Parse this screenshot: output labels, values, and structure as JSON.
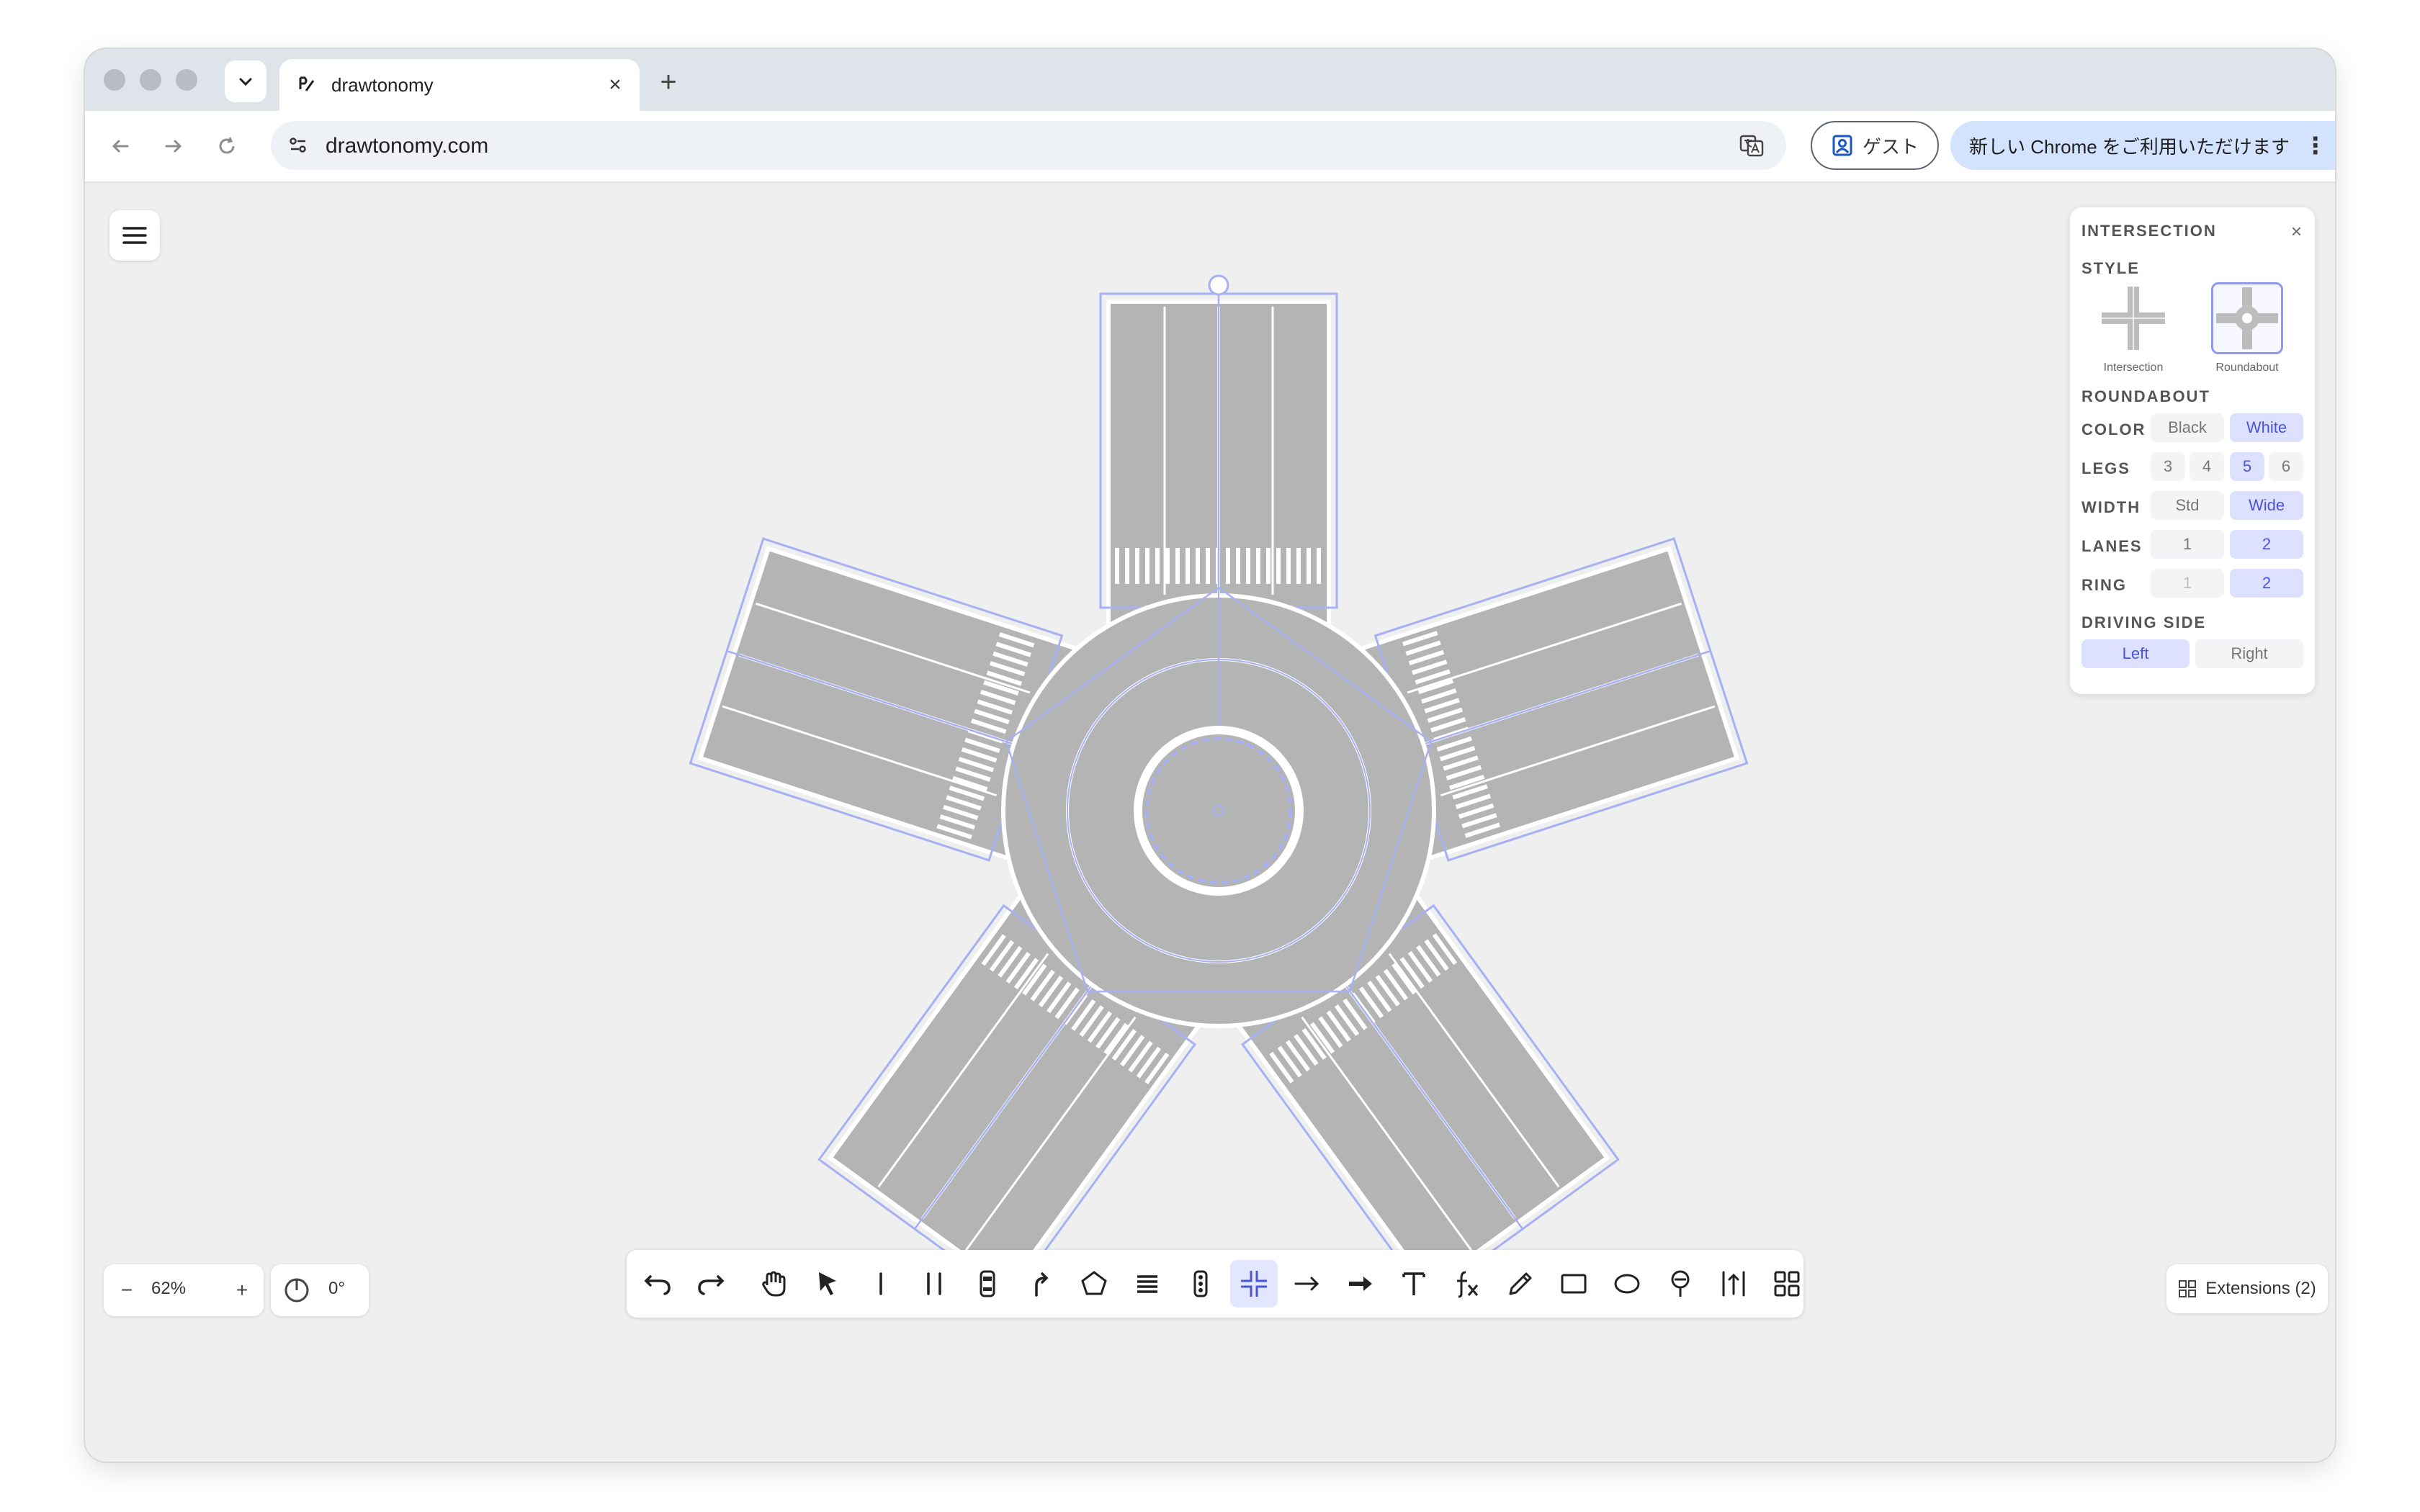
{
  "browser": {
    "tab_title": "drawtonomy",
    "tab_close": "×",
    "new_tab": "+",
    "url": "drawtonomy.com",
    "guest_label": "ゲスト",
    "update_label": "新しい Chrome をご利用いただけます",
    "update_more": "⋮"
  },
  "panel": {
    "title": "INTERSECTION",
    "close": "×",
    "style_label": "STYLE",
    "style_options": [
      "Intersection",
      "Roundabout"
    ],
    "style_selected": "Roundabout",
    "section_label": "ROUNDABOUT",
    "color_label": "COLOR",
    "color_options": [
      "Black",
      "White"
    ],
    "color_selected": "White",
    "legs_label": "LEGS",
    "legs_options": [
      "3",
      "4",
      "5",
      "6"
    ],
    "legs_selected": "5",
    "width_label": "WIDTH",
    "width_options": [
      "Std",
      "Wide"
    ],
    "width_selected": "Wide",
    "lanes_label": "LANES",
    "lanes_options": [
      "1",
      "2"
    ],
    "lanes_selected": "2",
    "ring_label": "RING",
    "ring_options": [
      "1",
      "2"
    ],
    "ring_selected": "2",
    "driving_side_label": "DRIVING SIDE",
    "driving_side_options": [
      "Left",
      "Right"
    ],
    "driving_side_selected": "Left"
  },
  "zoom": {
    "minus": "−",
    "value": "62%",
    "plus": "+"
  },
  "rotation": {
    "value": "0°"
  },
  "toolbar": {
    "tools": [
      "undo-icon",
      "redo-icon",
      "hand-icon",
      "select-arrow-icon",
      "single-line-icon",
      "double-line-icon",
      "vehicle-icon",
      "turn-path-icon",
      "polygon-icon",
      "crosswalk-icon",
      "traffic-light-icon",
      "intersection-icon",
      "arrow-icon",
      "bold-arrow-icon",
      "text-icon",
      "formula-icon",
      "pencil-icon",
      "rectangle-icon",
      "ellipse-icon",
      "sign-icon",
      "lane-arrow-icon",
      "grid-icon"
    ],
    "active_tool": "intersection-icon"
  },
  "extensions": {
    "label": "Extensions (2)"
  },
  "colors": {
    "accent": "#8e9af0",
    "road": "#b4b4b4",
    "selection": "#a7b0f5"
  }
}
